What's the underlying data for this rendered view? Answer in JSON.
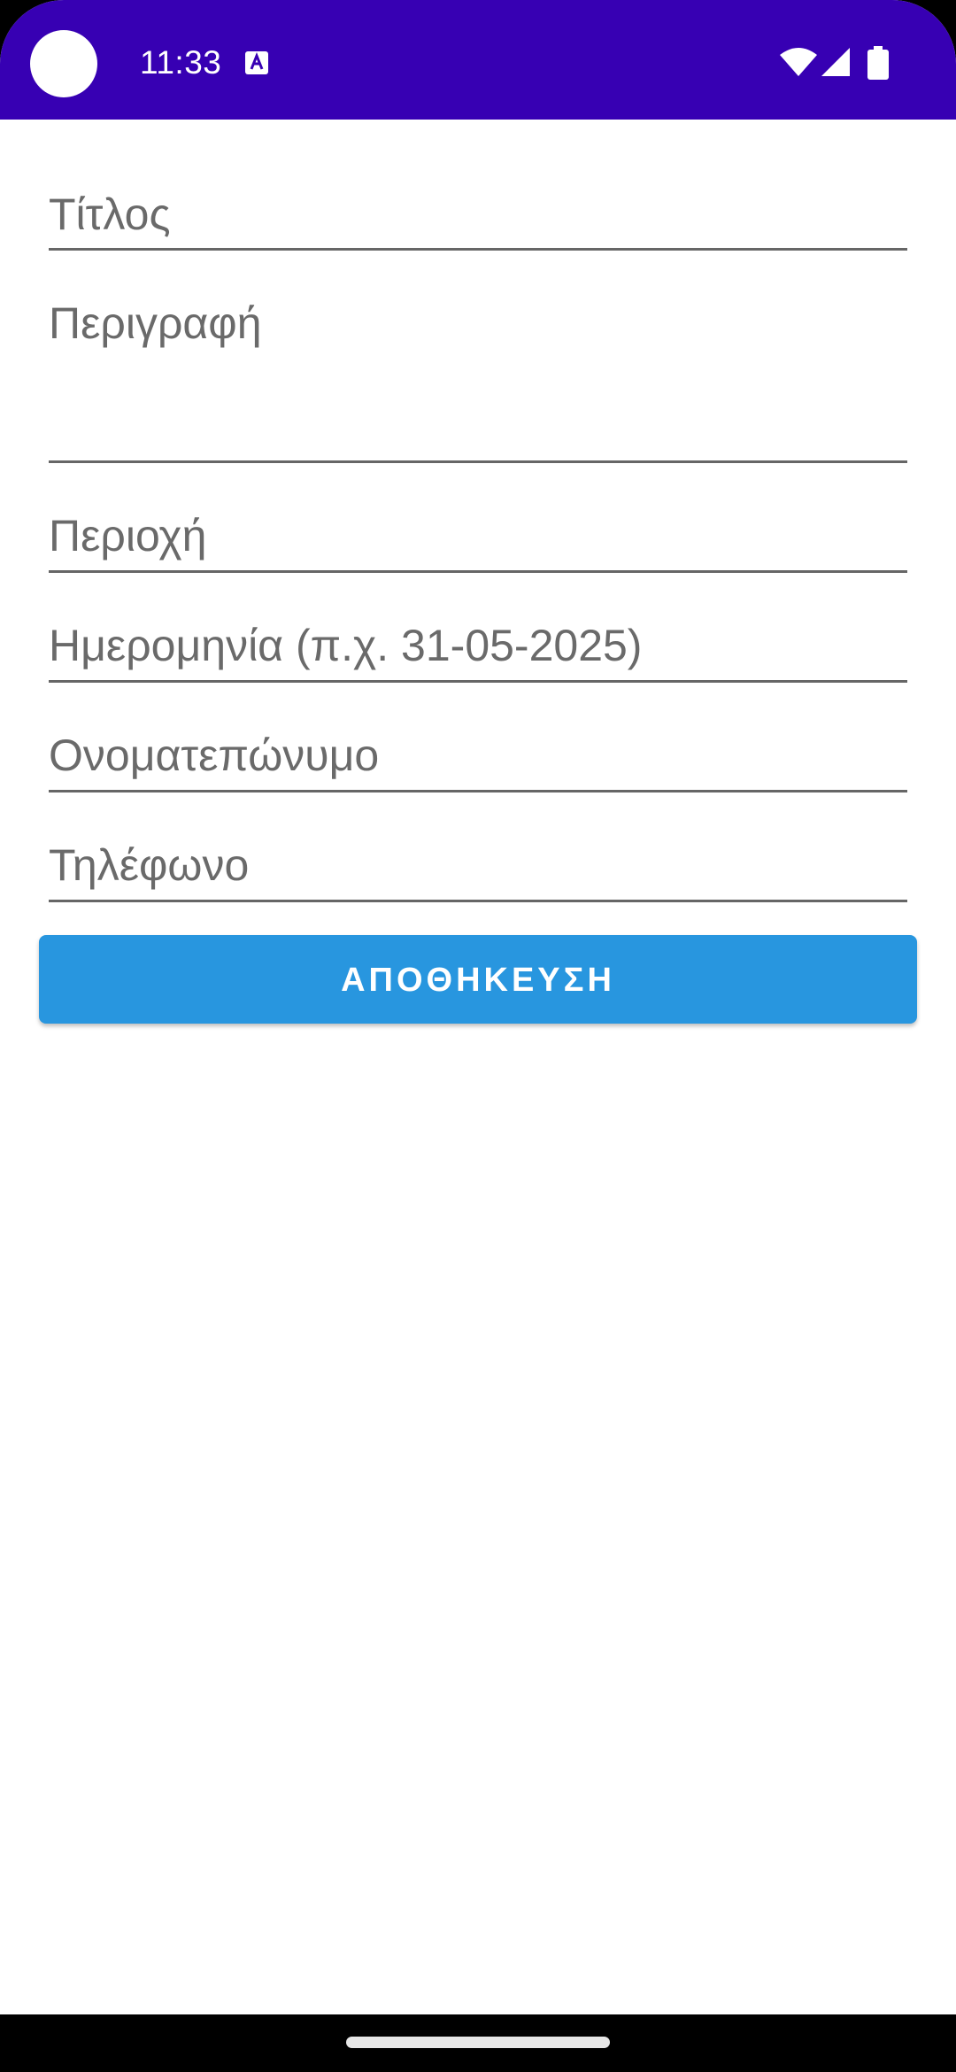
{
  "status_bar": {
    "time": "11:33",
    "background": "#3700B3",
    "icons": [
      "notification-a-icon",
      "wifi-icon",
      "signal-icon",
      "battery-icon"
    ]
  },
  "form": {
    "title_placeholder": "Τίτλος",
    "description_placeholder": "Περιγραφή",
    "area_placeholder": "Περιοχή",
    "date_placeholder": "Ημερομηνία (π.χ. 31-05-2025)",
    "fullname_placeholder": "Ονοματεπώνυμο",
    "phone_placeholder": "Τηλέφωνο"
  },
  "actions": {
    "save_label": "ΑΠΟΘΗΚΕΥΣΗ",
    "save_color": "#2896DF"
  }
}
